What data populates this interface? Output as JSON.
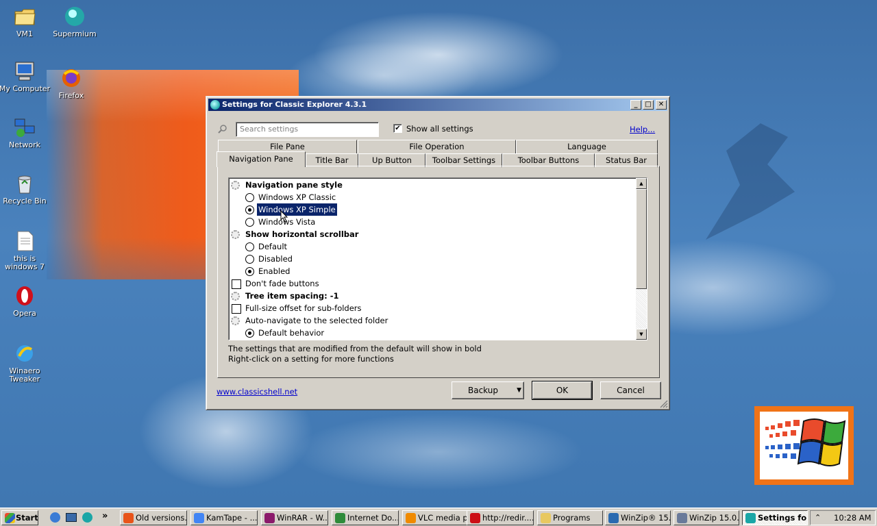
{
  "desktop": {
    "icons": [
      {
        "label": "VM1",
        "icon": "folder-icon"
      },
      {
        "label": "Supermium",
        "icon": "supermium-icon"
      },
      {
        "label": "My Computer",
        "icon": "computer-icon"
      },
      {
        "label": "Firefox",
        "icon": "firefox-icon"
      },
      {
        "label": "Network",
        "icon": "network-icon"
      },
      {
        "label": "Recycle Bin",
        "icon": "recycle-bin-icon"
      },
      {
        "label": "this is windows 7",
        "icon": "text-file-icon"
      },
      {
        "label": "Opera",
        "icon": "opera-icon"
      },
      {
        "label": "Winaero Tweaker",
        "icon": "winaero-icon"
      }
    ]
  },
  "window": {
    "title": "Settings for Classic Explorer 4.3.1",
    "buttons": {
      "minimize": "_",
      "maximize": "□",
      "close": "✕"
    },
    "search_placeholder": "Search settings",
    "show_all_label": "Show all settings",
    "show_all_checked": true,
    "help_link": "Help...",
    "tabs_row1": [
      "File Pane",
      "File Operation",
      "Language"
    ],
    "tabs_row2": [
      "Navigation Pane",
      "Title Bar",
      "Up Button",
      "Toolbar Settings",
      "Toolbar Buttons",
      "Status Bar"
    ],
    "active_tab": "Navigation Pane",
    "settings": [
      {
        "label": "Navigation pane style",
        "kind": "group",
        "bold": true
      },
      {
        "label": "Windows XP Classic",
        "kind": "radio",
        "checked": false
      },
      {
        "label": "Windows XP Simple",
        "kind": "radio",
        "checked": true,
        "selected": true
      },
      {
        "label": "Windows Vista",
        "kind": "radio",
        "checked": false
      },
      {
        "label": "Show horizontal scrollbar",
        "kind": "group",
        "bold": true
      },
      {
        "label": "Default",
        "kind": "radio",
        "checked": false
      },
      {
        "label": "Disabled",
        "kind": "radio",
        "checked": false
      },
      {
        "label": "Enabled",
        "kind": "radio",
        "checked": true
      },
      {
        "label": "Don't fade buttons",
        "kind": "checkbox",
        "checked": false
      },
      {
        "label": "Tree item spacing: -1",
        "kind": "group",
        "bold": true
      },
      {
        "label": "Full-size offset for sub-folders",
        "kind": "checkbox",
        "checked": false
      },
      {
        "label": "Auto-navigate to the selected folder",
        "kind": "group",
        "bold": false
      },
      {
        "label": "Default behavior",
        "kind": "radio",
        "checked": true
      }
    ],
    "hint_line1": "The settings that are modified from the default will show in bold",
    "hint_line2": "Right-click on a setting for more functions",
    "website_link": "www.classicshell.net",
    "backup_label": "Backup",
    "ok_label": "OK",
    "cancel_label": "Cancel"
  },
  "taskbar": {
    "start_label": "Start",
    "chevron": "»",
    "items": [
      {
        "label": "Old versions...",
        "color": "#e8541a"
      },
      {
        "label": "KamTape - ...",
        "color": "#4285f4"
      },
      {
        "label": "WinRAR - W...",
        "color": "#8b1a6b"
      },
      {
        "label": "Internet Do...",
        "color": "#2e8b3a"
      },
      {
        "label": "VLC media p...",
        "color": "#f08a00"
      },
      {
        "label": "http://redir....",
        "color": "#cc0f16"
      },
      {
        "label": "Programs",
        "color": "#e8c860"
      },
      {
        "label": "WinZip® 15...",
        "color": "#2a6ab0"
      },
      {
        "label": "WinZip 15.0...",
        "color": "#6a7a9a"
      },
      {
        "label": "Settings fo...",
        "color": "#1aa6a6"
      }
    ],
    "clock": "10:28 AM"
  }
}
